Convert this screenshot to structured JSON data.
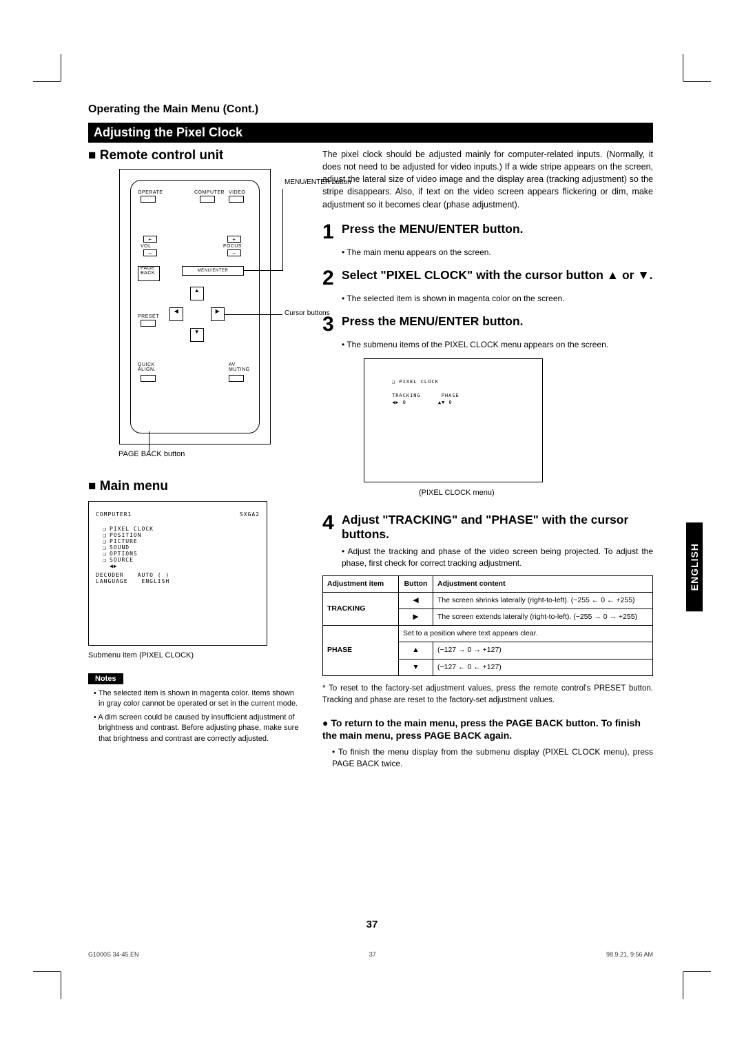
{
  "header": "Operating the Main Menu (Cont.)",
  "title_bar": "Adjusting the Pixel Clock",
  "remote_heading": "Remote control unit",
  "remote": {
    "menu_enter": "MENU/ENTER button",
    "cursor": "Cursor buttons",
    "page_back": "PAGE BACK button",
    "operate": "OPERATE",
    "computer": "COMPUTER",
    "video": "VIDEO",
    "vol": "VOL",
    "focus": "FOCUS",
    "menu_btn": "MENU/ENTER",
    "pageback_btn": "PAGE BACK",
    "preset": "PRESET",
    "quick": "QUICK ALIGN.",
    "av": "AV MUTING"
  },
  "mainmenu_heading": "Main menu",
  "mainmenu": {
    "src_l": "COMPUTER1",
    "src_r": "SXGA2",
    "items": [
      "PIXEL CLOCK",
      "POSITION",
      "PICTURE",
      "SOUND",
      "OPTIONS",
      "SOURCE"
    ],
    "arrows_label": "◀▶",
    "decoder_l": "DECODER",
    "decoder_r": "AUTO (    )",
    "lang_l": "LANGUAGE",
    "lang_r": "ENGLISH"
  },
  "mainmenu_caption": "Submenu item (PIXEL CLOCK)",
  "notes_label": "Notes",
  "notes": [
    "The selected item is shown in magenta color. Items shown in gray color cannot be operated or set in the current mode.",
    "A dim screen could be caused by insufficient adjustment of brightness and contrast. Before adjusting phase, make sure that brightness and contrast are correctly adjusted."
  ],
  "intro": "The pixel clock should be adjusted mainly for computer-related inputs. (Normally, it does not need to be adjusted for video inputs.) If a wide stripe appears on the screen, adjust the lateral size of video image and the display area (tracking adjustment) so the stripe disappears. Also, if text on the video screen appears flickering or dim, make adjustment so it becomes clear (phase adjustment).",
  "steps": {
    "s1": "Press the MENU/ENTER button.",
    "s1b": "The main menu appears on the screen.",
    "s2": "Select \"PIXEL CLOCK\" with the cursor button ▲ or ▼.",
    "s2b": "The selected item is shown in magenta color on the screen.",
    "s3": "Press the MENU/ENTER button.",
    "s3b": "The submenu items of the PIXEL CLOCK menu appears on the screen.",
    "s4": "Adjust \"TRACKING\" and \"PHASE\" with the cursor buttons.",
    "s4b": "Adjust the tracking and phase of the video screen being projected. To adjust the phase, first check for correct tracking adjustment."
  },
  "submenu": {
    "title": "❑ PIXEL CLOCK",
    "tracking": "TRACKING",
    "phase": "PHASE",
    "t_val": "◀▶    0",
    "p_val": "▲▼    0",
    "caption": "(PIXEL CLOCK menu)"
  },
  "table": {
    "h1": "Adjustment item",
    "h2": "Button",
    "h3": "Adjustment content",
    "tracking": "TRACKING",
    "phase": "PHASE",
    "t_left": "The screen shrinks laterally (right-to-left). (−255 ← 0 ← +255)",
    "t_right": "The screen extends laterally (right-to-left). (−255 → 0 → +255)",
    "p_clear": "Set to a position where text appears clear.",
    "p_up": "(−127 → 0 → +127)",
    "p_down": "(−127 ← 0 ← +127)"
  },
  "reset_note": "* To reset to the factory-set adjustment values, press the remote control's PRESET button. Tracking and phase are reset to the factory-set adjustment values.",
  "final_lead": "To return to the main menu, press the PAGE BACK button. To finish the main menu, press PAGE BACK again.",
  "final_bullet": "To finish the menu display from the submenu display (PIXEL CLOCK menu), press PAGE BACK twice.",
  "lang_tab": "ENGLISH",
  "page_num": "37",
  "footer_l": "G1000S 34-45.EN",
  "footer_c": "37",
  "footer_r": "98.9.21, 9:56 AM"
}
